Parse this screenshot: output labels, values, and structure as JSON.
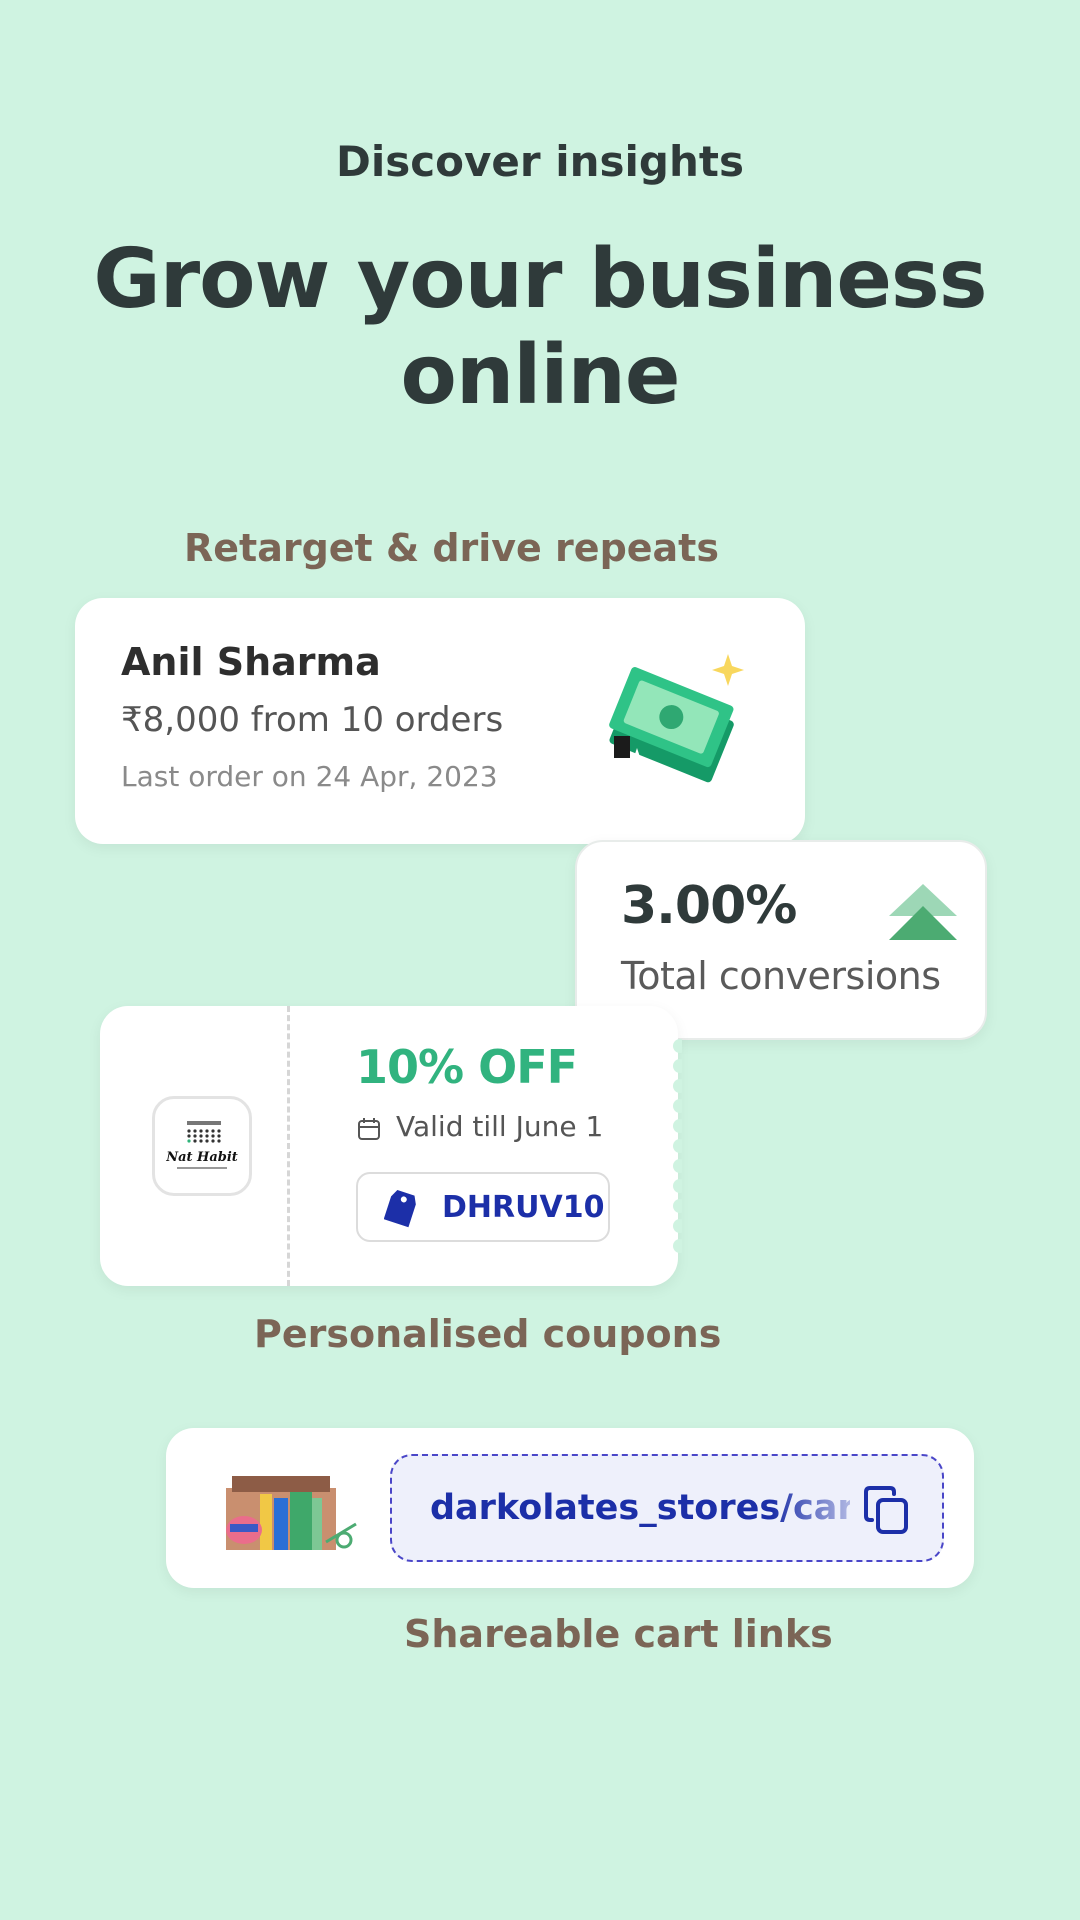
{
  "header": {
    "eyebrow": "Discover insights",
    "title_line1": "Grow your business",
    "title_line2": "online"
  },
  "retarget": {
    "label": "Retarget & drive repeats",
    "customer_name": "Anil Sharma",
    "amount_line": "₹8,000 from 10 orders",
    "last_order": "Last order on 24 Apr, 2023",
    "icon": "money-sparkle-icon"
  },
  "conversions": {
    "value": "3.00%",
    "label": "Total conversions",
    "icon": "double-chevron-up-icon"
  },
  "coupon": {
    "label": "Personalised coupons",
    "discount": "10% OFF",
    "validity": "Valid till June 1",
    "code": "DHRUV10",
    "brand_logo": "Nat Habit",
    "icons": [
      "calendar-icon",
      "tag-icon"
    ]
  },
  "cart_link": {
    "label": "Shareable cart links",
    "url": "darkolates_stores/cart/",
    "icons": [
      "products-box-icon",
      "copy-icon"
    ]
  },
  "colors": {
    "background": "#cff3e1",
    "accent_green": "#31b37f",
    "code_blue": "#1c2fa8",
    "label_brown": "#7b6556",
    "dark_text": "#2f3a3a"
  }
}
